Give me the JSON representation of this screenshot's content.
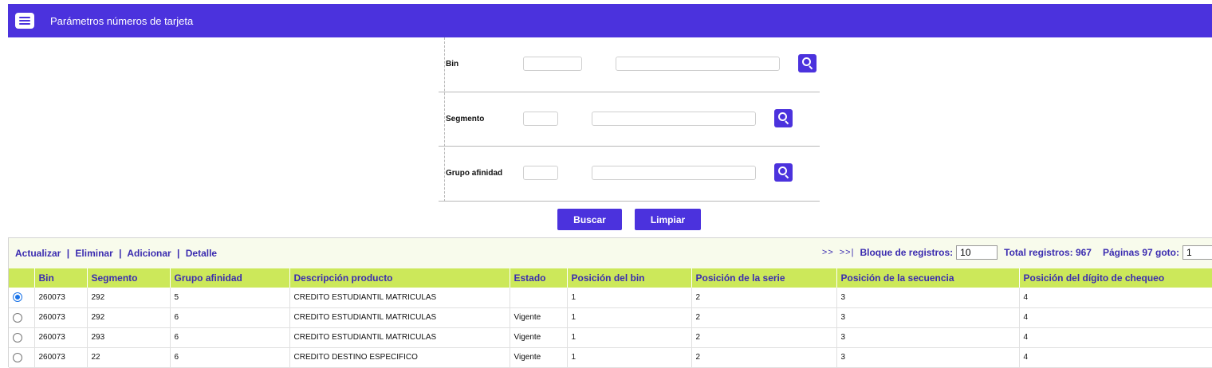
{
  "header": {
    "title": "Parámetros números de tarjeta",
    "icon": "form-list-icon"
  },
  "form": {
    "bin": {
      "label": "Bin",
      "code_value": "",
      "desc_value": ""
    },
    "segmento": {
      "label": "Segmento",
      "code_value": "",
      "desc_value": ""
    },
    "grupo": {
      "label": "Grupo afinidad",
      "code_value": "",
      "desc_value": ""
    },
    "search_icon": "search-icon",
    "buscar_label": "Buscar",
    "limpiar_label": "Limpiar"
  },
  "toolbar": {
    "actualizar": "Actualizar",
    "eliminar": "Eliminar",
    "adicionar": "Adicionar",
    "detalle": "Detalle",
    "sep": "|",
    "nav_next": ">>",
    "nav_last": ">>|",
    "bloque_label": "Bloque de registros:",
    "bloque_value": "10",
    "total_label": "Total registros: 967",
    "paginas_label": "Páginas 97 goto:",
    "goto_value": "1"
  },
  "table": {
    "columns": [
      "",
      "Bin",
      "Segmento",
      "Grupo afinidad",
      "Descripción producto",
      "Estado",
      "Posición del bin",
      "Posición de la serie",
      "Posición de la secuencia",
      "Posición del dígito de chequeo"
    ],
    "rows": [
      {
        "selected": true,
        "bin": "260073",
        "segmento": "292",
        "grupo": "5",
        "descripcion": "CREDITO ESTUDIANTIL MATRICULAS",
        "estado": "",
        "pos_bin": "1",
        "pos_serie": "2",
        "pos_secuencia": "3",
        "pos_digito": "4"
      },
      {
        "selected": false,
        "bin": "260073",
        "segmento": "292",
        "grupo": "6",
        "descripcion": "CREDITO ESTUDIANTIL MATRICULAS",
        "estado": "Vigente",
        "pos_bin": "1",
        "pos_serie": "2",
        "pos_secuencia": "3",
        "pos_digito": "4"
      },
      {
        "selected": false,
        "bin": "260073",
        "segmento": "293",
        "grupo": "6",
        "descripcion": "CREDITO ESTUDIANTIL MATRICULAS",
        "estado": "Vigente",
        "pos_bin": "1",
        "pos_serie": "2",
        "pos_secuencia": "3",
        "pos_digito": "4"
      },
      {
        "selected": false,
        "bin": "260073",
        "segmento": "22",
        "grupo": "6",
        "descripcion": "CREDITO DESTINO ESPECIFICO",
        "estado": "Vigente",
        "pos_bin": "1",
        "pos_serie": "2",
        "pos_secuencia": "3",
        "pos_digito": "4"
      }
    ]
  },
  "colors": {
    "accent": "#4b32dd",
    "header_row": "#cce85a",
    "link": "#3b2cb0",
    "toolbar_bg": "#f8fbec"
  }
}
